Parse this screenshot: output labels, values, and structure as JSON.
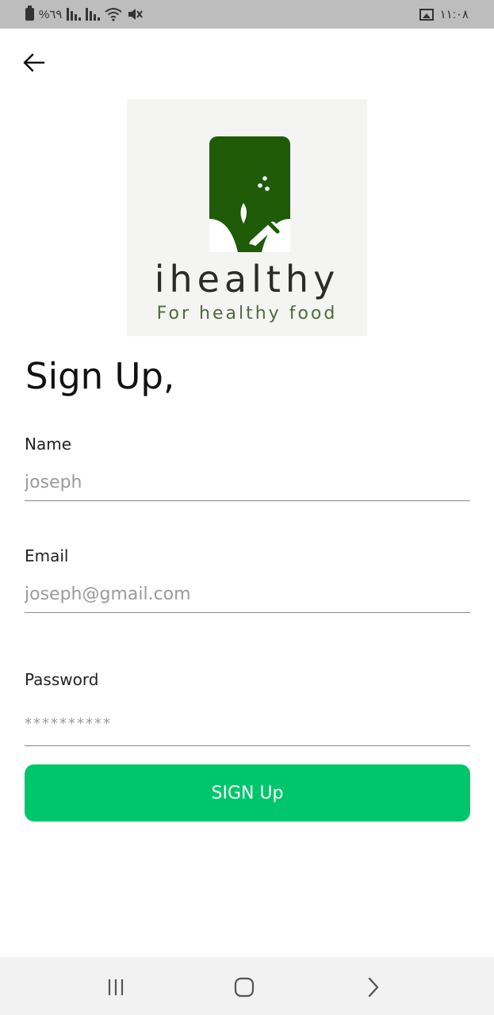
{
  "status_bar": {
    "battery_text": "%٦٩",
    "time": "١١:٠٨"
  },
  "logo": {
    "wordmark": "ihealthy",
    "tagline": "For healthy food",
    "colors": {
      "mark": "#1f5a06",
      "card_bg": "#f4f4f3"
    }
  },
  "form": {
    "title": "Sign Up,",
    "name": {
      "label": "Name",
      "placeholder": "joseph"
    },
    "email": {
      "label": "Email",
      "placeholder": "joseph@gmail.com"
    },
    "password": {
      "label": "Password",
      "placeholder": "**********"
    },
    "submit_label": "SIGN Up"
  },
  "colors": {
    "accent": "#00c66b",
    "status_bar": "#bdbdbd",
    "nav_bar": "#f2f2f2"
  },
  "icons": [
    "battery-icon",
    "signal-icon",
    "wifi-icon",
    "mute-icon",
    "gallery-icon",
    "back-arrow-icon",
    "recent-apps-icon",
    "home-icon",
    "back-chevron-icon"
  ]
}
